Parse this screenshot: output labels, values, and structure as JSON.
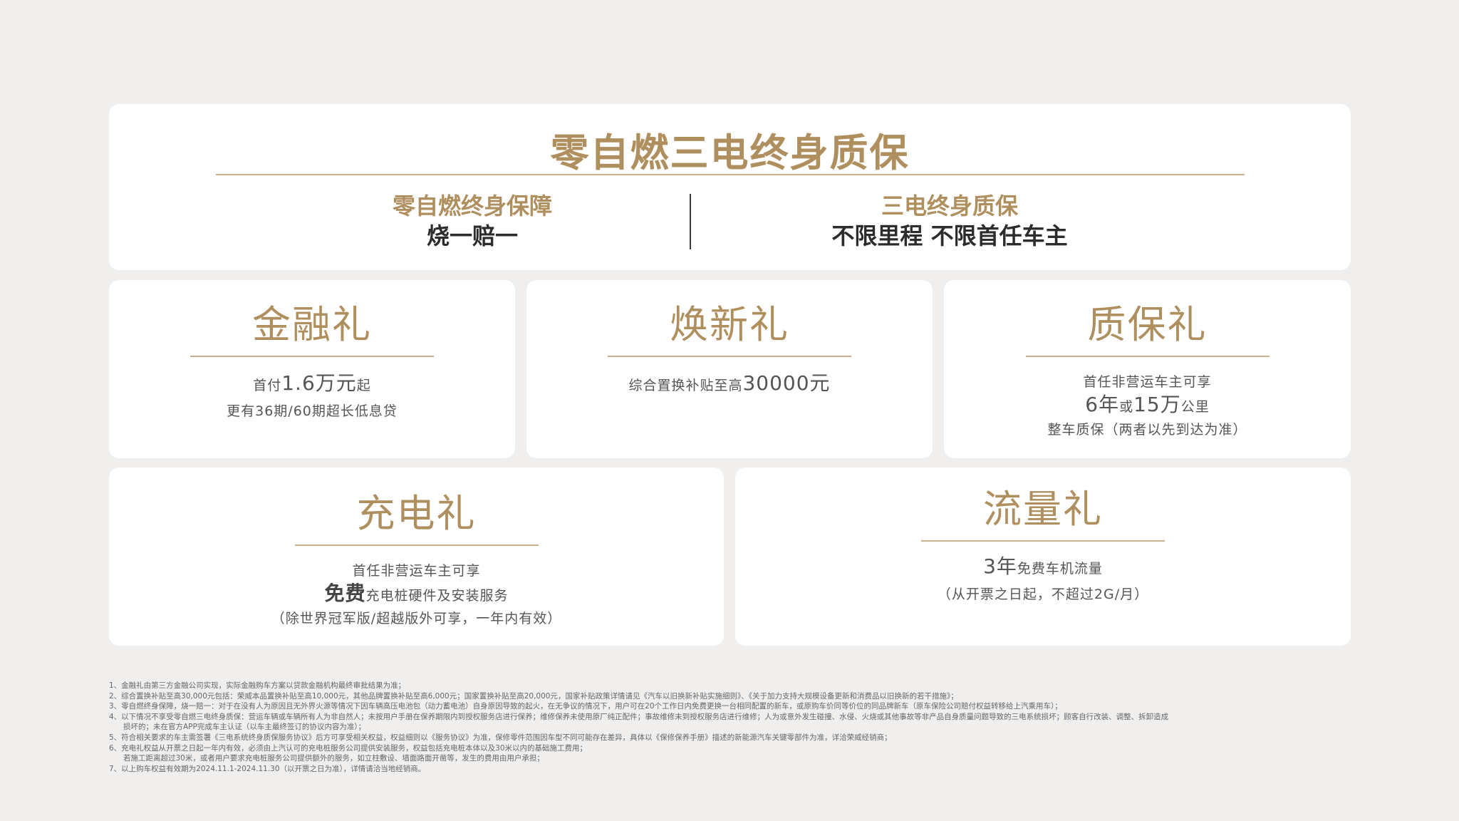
{
  "top": {
    "title": "零自燃三电终身质保",
    "left_heading": "零自燃终身保障",
    "left_body": "烧一赔一",
    "right_heading": "三电终身质保",
    "right_body": "不限里程 不限首任车主"
  },
  "finance": {
    "title": "金融礼",
    "line1_prefix": "首付",
    "line1_value": "1.6万元",
    "line1_suffix": "起",
    "line2": "更有36期/60期超长低息贷"
  },
  "renew": {
    "title": "焕新礼",
    "line1_prefix": "综合置换补贴至高",
    "line1_value": "30000元"
  },
  "warranty": {
    "title": "质保礼",
    "line1": "首任非营运车主可享",
    "line2_a": "6年",
    "line2_b": "或",
    "line2_c": "15万",
    "line2_d": "公里",
    "line3": "整车质保（两者以先到达为准）"
  },
  "charge": {
    "title": "充电礼",
    "line1": "首任非营运车主可享",
    "line2_value": "免费",
    "line2_suffix": "充电桩硬件及安装服务",
    "line3": "（除世界冠军版/超越版外可享，一年内有效）"
  },
  "data_gift": {
    "title": "流量礼",
    "line1_value": "3年",
    "line1_suffix": "免费车机流量",
    "line2": "（从开票之日起，不超过2G/月）"
  },
  "notes": [
    "1、金融礼由第三方金融公司实现，实际金融购车方案以贷款金融机构最终审批结果为准；",
    "2、综合置换补贴至高30,000元包括：荣威本品置换补贴至高10,000元，其他品牌置换补贴至高6,000元；国家置换补贴至高20,000元，国家补贴政策详情请见《汽车以旧换新补贴实施细则》、《关于加力支持大规模设备更新和消费品以旧换新的若干措施》；",
    "3、零自燃终身保障，烧一赔一：对于在没有人为原因且无外界火源等情况下因车辆高压电池包（动力蓄电池）自身原因导致的起火，在无争议的情况下，用户可在20个工作日内免费更换一台相同配置的新车，或原购车价同等价位的同品牌新车（原车保险公司赔付权益转移给上汽乘用车）；",
    "4、以下情况不享受零自燃三电终身质保：营运车辆或车辆所有人为非自然人；未按用户手册在保养期限内到授权服务店进行保养；维修保养未使用原厂纯正配件；事故维修未到授权服务店进行维修；人为或意外发生碰撞、水侵、火烧或其他事故等非产品自身质量问题导致的三电系统损坏；顾客自行改装、调整、拆卸造成",
    "损坏的；未在官方APP完成车主认证（以车主最终签订的协议内容为准）；",
    "5、符合相关要求的车主需签署《三电系统终身质保服务协议》后方可享受相关权益，权益细则以《服务协议》为准，保修零件范围因车型不同可能存在差异，具体以《保修保养手册》描述的新能源汽车关键零部件为准，详洽荣威经销商；",
    "6、充电礼权益从开票之日起一年内有效，必须由上汽认可的充电桩服务公司提供安装服务，权益包括充电桩本体以及30米以内的基础施工费用；",
    "若施工距离超过30米，或者用户要求充电桩服务公司提供额外的服务，如立柱敷设、墙面路面开凿等，发生的费用由用户承担；",
    "7、以上购车权益有效期为2024.11.1-2024.11.30（以开票之日为准），详情请洽当地经销商。"
  ],
  "colors": {
    "accent": "#b08f5f",
    "background": "#f0efed",
    "card": "#ffffff"
  }
}
